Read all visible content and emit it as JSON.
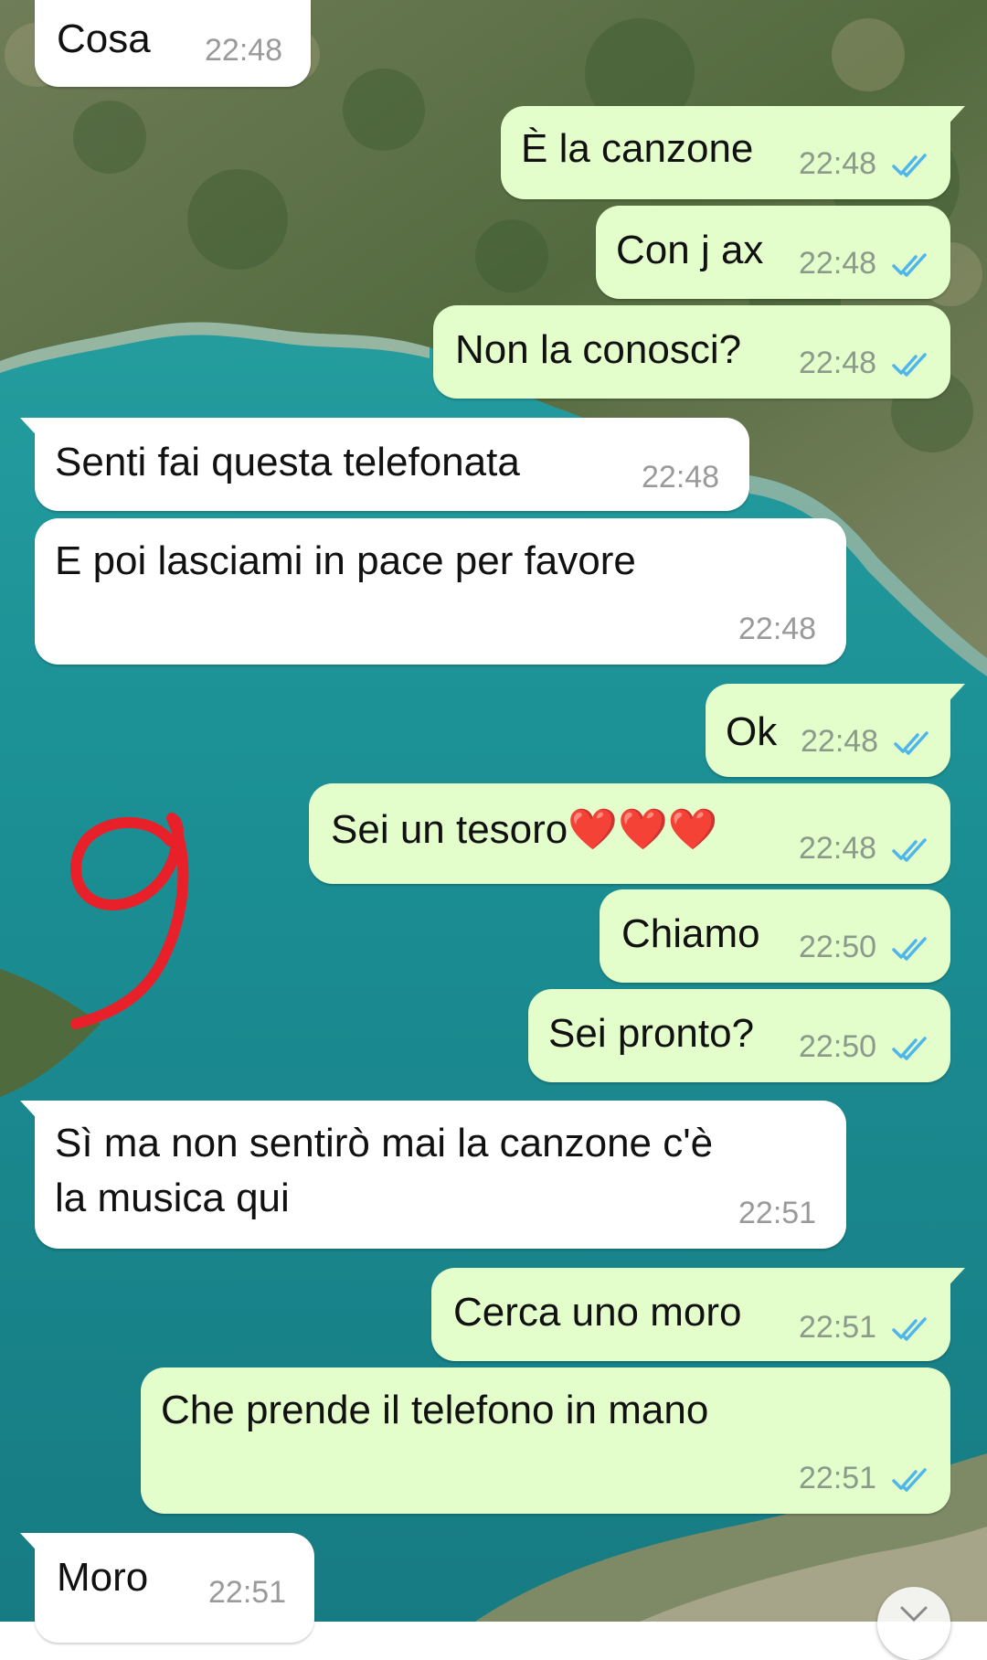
{
  "chat": {
    "messages": [
      {
        "dir": "in",
        "text": "Cosa",
        "time": "22:48"
      },
      {
        "dir": "out",
        "text": "È la canzone",
        "time": "22:48",
        "status": "read"
      },
      {
        "dir": "out",
        "text": "Con j ax",
        "time": "22:48",
        "status": "read"
      },
      {
        "dir": "out",
        "text": "Non la conosci?",
        "time": "22:48",
        "status": "read"
      },
      {
        "dir": "in",
        "text": "Senti fai questa telefonata",
        "time": "22:48"
      },
      {
        "dir": "in",
        "text": "E poi lasciami in pace per favore",
        "time": "22:48"
      },
      {
        "dir": "out",
        "text": "Ok",
        "time": "22:48",
        "status": "read"
      },
      {
        "dir": "out",
        "text": "Sei un tesoro❤️❤️❤️",
        "time": "22:48",
        "status": "read"
      },
      {
        "dir": "out",
        "text": "Chiamo",
        "time": "22:50",
        "status": "read"
      },
      {
        "dir": "out",
        "text": "Sei pronto?",
        "time": "22:50",
        "status": "read"
      },
      {
        "dir": "in",
        "text_line1": "Sì ma non sentirò mai la canzone c'è",
        "text_line2": "la musica qui",
        "time": "22:51"
      },
      {
        "dir": "out",
        "text": "Cerca uno moro",
        "time": "22:51",
        "status": "read"
      },
      {
        "dir": "out",
        "text": "Che prende il telefono in mano",
        "time": "22:51",
        "status": "read"
      },
      {
        "dir": "in",
        "text": "Moro",
        "time": "22:51"
      }
    ]
  },
  "annotation": {
    "icon": "red-handwritten-nine"
  },
  "colors": {
    "incoming": "#ffffff",
    "outgoing": "#e3fecb",
    "tick": "#4fb6ec",
    "annotation": "#e8202a"
  }
}
